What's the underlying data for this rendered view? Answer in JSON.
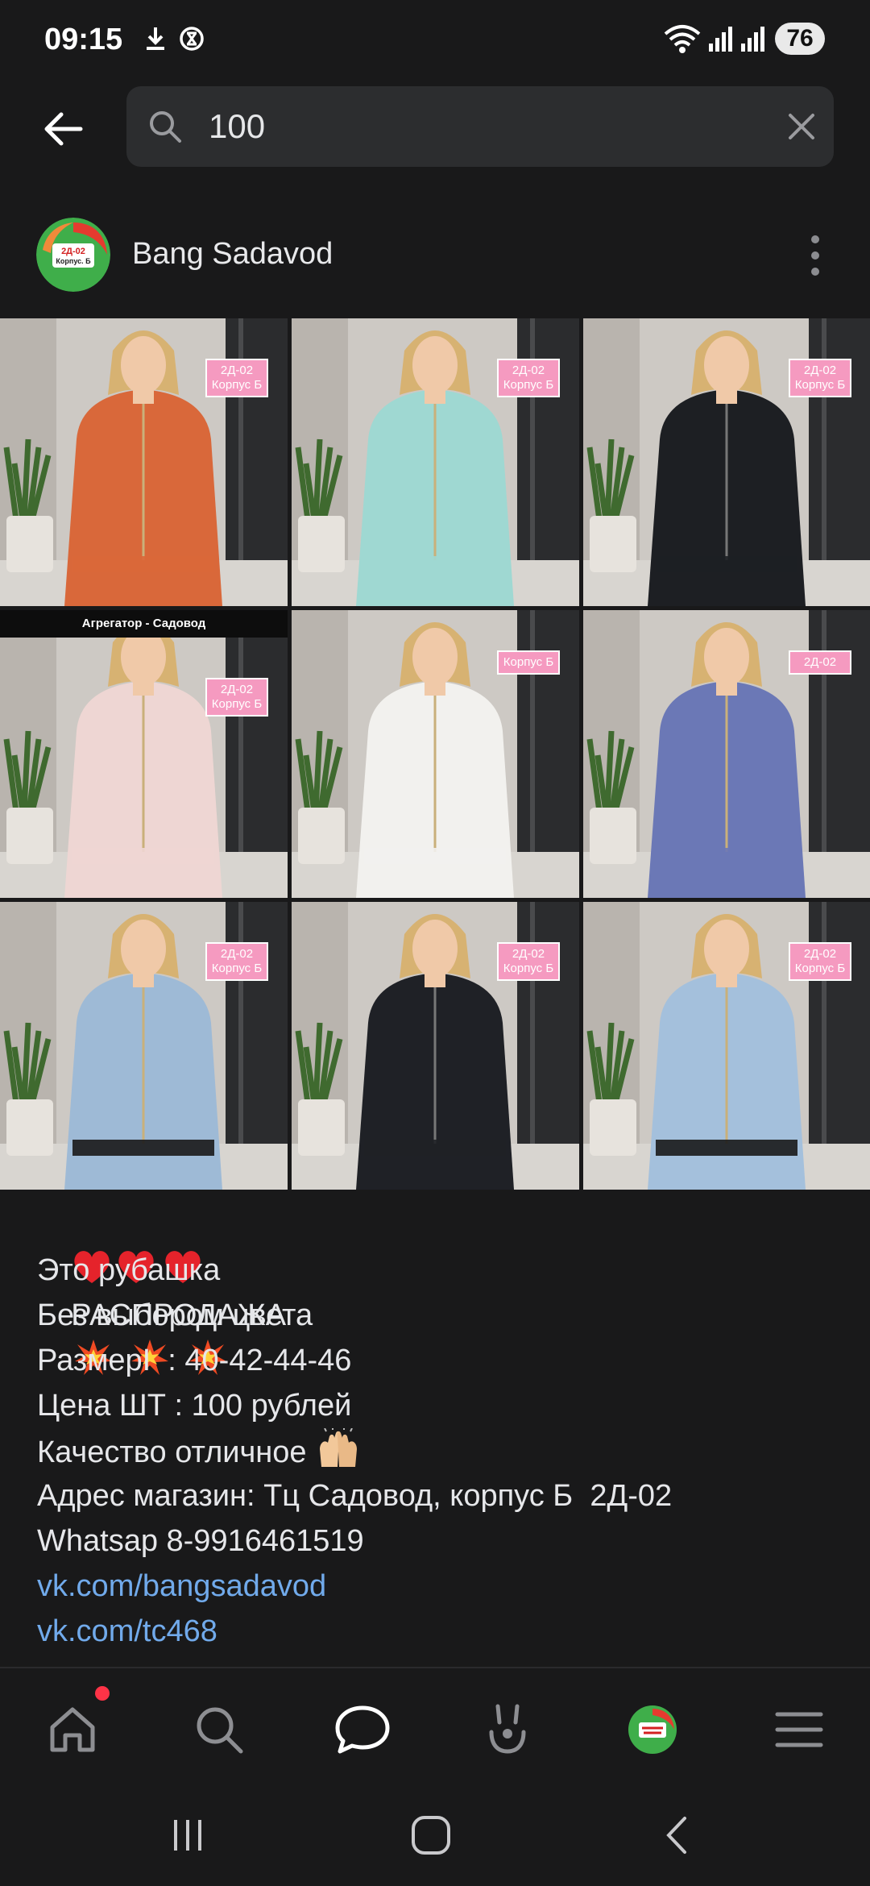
{
  "status_bar": {
    "time": "09:15",
    "battery": "76",
    "icons": [
      "download-icon",
      "data-saver-icon",
      "wifi-icon",
      "signal-icon",
      "signal-icon"
    ]
  },
  "search": {
    "value": "100",
    "icons": [
      "back-arrow-icon",
      "search-icon",
      "clear-icon"
    ]
  },
  "post": {
    "author": "Bang Sadavod",
    "avatar_text": [
      "2Д-02",
      "Корпус. Б"
    ],
    "photos": [
      {
        "tag": "2Д-02 Корпус Б",
        "garment": "orange-jacket",
        "color": "#d9683a"
      },
      {
        "tag": "2Д-02 Корпус Б",
        "garment": "mint-jacket",
        "color": "#9fd8d2"
      },
      {
        "tag": "2Д-02 Корпус Б",
        "garment": "black-quilted-jacket",
        "color": "#1d1f23"
      },
      {
        "tag": "2Д-02 Корпус Б",
        "banner": "Агрегатор - Садовод",
        "garment": "pink-tracksuit",
        "color": "#eed6d3"
      },
      {
        "tag": "Корпус Б",
        "garment": "white-jacket",
        "color": "#f2f1ee"
      },
      {
        "tag": "2Д-02",
        "garment": "floral-blouse",
        "color": "#6b78b6"
      },
      {
        "tag": "2Д-02 Корпус Б",
        "garment": "light-blue-bomber",
        "color": "#9ebad6"
      },
      {
        "tag": "2Д-02 Корпус Б",
        "garment": "black-quilted-jacket",
        "color": "#1f2126"
      },
      {
        "tag": "2Д-02 Корпус Б",
        "garment": "light-blue-bomber",
        "color": "#a4c0dc"
      }
    ],
    "text": {
      "headline": "РАСПРОДАЖА",
      "line1": "Это рубашка",
      "line2": "Без выбором цвета",
      "line3": "РазмерI  : 40-42-44-46",
      "line4": "Цена ШТ : 100 рублей",
      "line5": "Качество отличное",
      "line6": "Адрес магазин: Тц Садовод, корпус Б  2Д-02",
      "line7": "Whatsap 8-9916461519",
      "link1": "vk.com/bangsadavod",
      "link2": "vk.com/tc468"
    },
    "emoji": [
      "red-heart-icon",
      "red-heart-icon",
      "red-heart-icon",
      "collision-icon",
      "collision-icon",
      "collision-icon",
      "raised-hands-icon"
    ]
  },
  "tabbar": {
    "items": [
      "home-icon",
      "search-icon",
      "messages-icon",
      "clips-icon",
      "profile-avatar",
      "menu-icon"
    ],
    "active": "messages-icon",
    "home_badge_color": "#ff3347"
  },
  "colors": {
    "background": "#19191a",
    "search_field": "#2c2d2f",
    "link": "#71aaeb",
    "tag_pink": "#f59ac0"
  }
}
